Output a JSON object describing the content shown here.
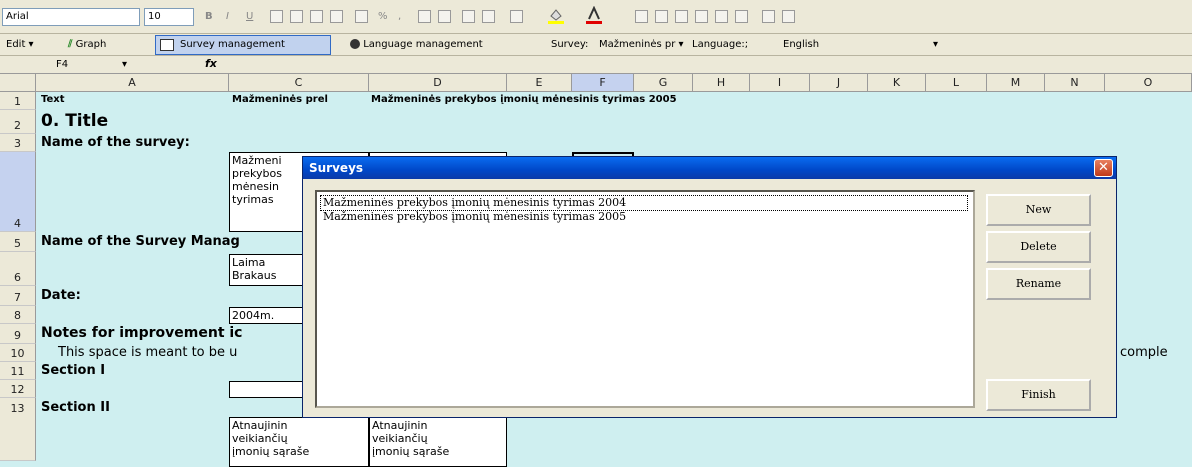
{
  "toolbar1": {
    "font_name": "Arial",
    "font_size": "10",
    "bold": "B",
    "italic": "I",
    "underline": "U",
    "percent": "%",
    "comma": ","
  },
  "toolbar2": {
    "edit_label": "Edit",
    "graph_label": "Graph",
    "survey_mgmt_label": "Survey management",
    "language_mgmt_label": "Language management",
    "survey_label": "Survey:",
    "survey_value": "Mažmeninės pr",
    "language_label": "Language:;",
    "language_value": "English"
  },
  "formula_bar": {
    "cell_ref": "F4",
    "fx": "fx"
  },
  "columns": [
    "A",
    "C",
    "D",
    "E",
    "F",
    "G",
    "H",
    "I",
    "J",
    "K",
    "L",
    "M",
    "N",
    "O"
  ],
  "rows": {
    "r1_a": "Text",
    "r1_c": "Mažmeninės prel",
    "r1_d": "Mažmeninės prekybos įmonių mėnesinis tyrimas 2005",
    "r2_a": "0. Title",
    "r3_a": "Name of the survey:",
    "r4_c": [
      "Mažmeni",
      "prekybos",
      "mėnesin",
      "tyrimas"
    ],
    "r5_a": "Name of the Survey Manag",
    "r6_c": [
      "Laima",
      "Brakaus"
    ],
    "r7_a": "Date:",
    "r8_c": "2004m.",
    "r9_a": "Notes for improvement ic",
    "r10_a": "This space is meant to be u",
    "r10_right": "comple",
    "r11_a": "Section I",
    "r13_a": "Section II",
    "r13_c": [
      "Atnaujinin",
      "veikiančių",
      "įmonių sąraše"
    ],
    "r13_d": [
      "Atnaujinin",
      "veikiančių",
      "įmonių sąraše"
    ]
  },
  "row_numbers": [
    "1",
    "2",
    "3",
    "4",
    "5",
    "6",
    "7",
    "8",
    "9",
    "10",
    "11",
    "12",
    "13"
  ],
  "dialog": {
    "title": "Surveys",
    "items": [
      "Mažmeninės prekybos įmonių mėnesinis tyrimas 2004",
      "Mažmeninės prekybos įmonių mėnesinis tyrimas 2005"
    ],
    "new_label": "New",
    "delete_label": "Delete",
    "rename_label": "Rename",
    "finish_label": "Finish",
    "close_glyph": "✕"
  }
}
